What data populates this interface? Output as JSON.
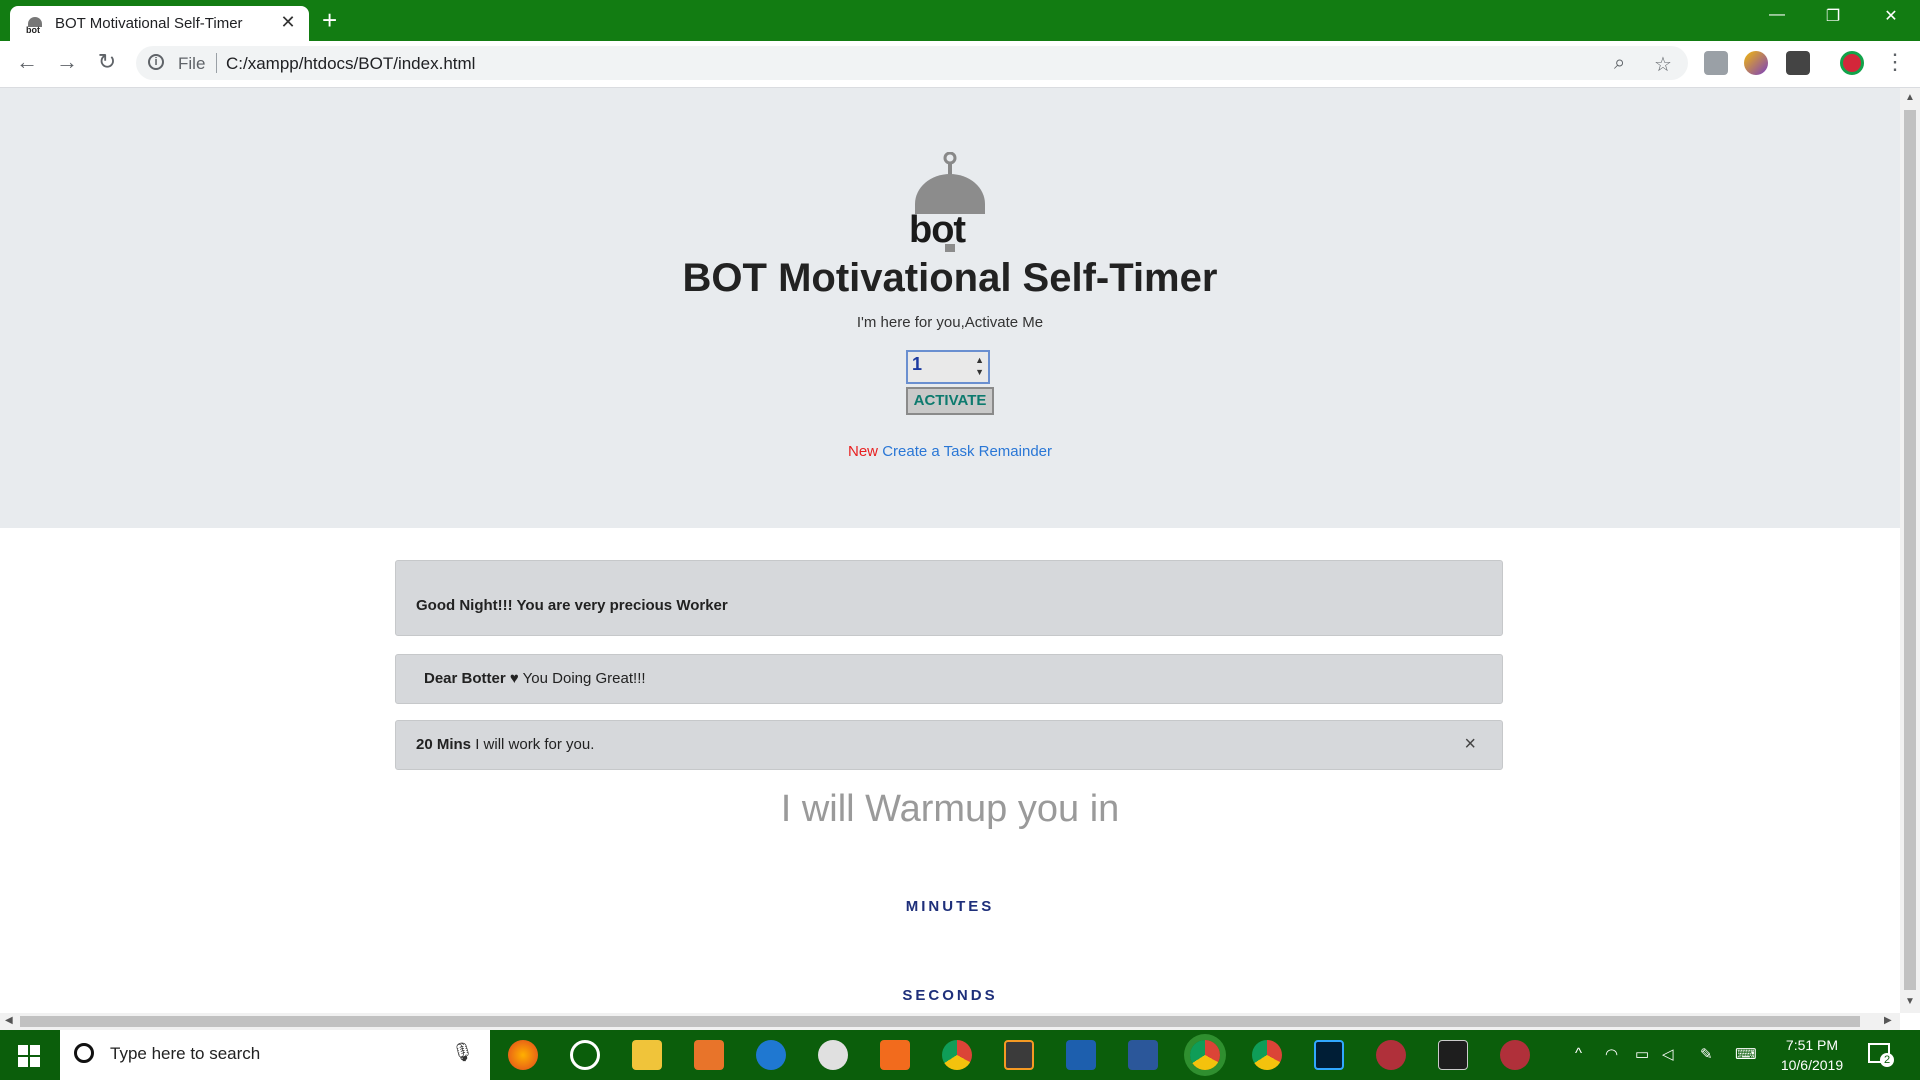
{
  "browser": {
    "tab_title": "BOT Motivational Self-Timer",
    "tab_close": "✕",
    "new_tab": "+",
    "window_controls": [
      "—",
      "❐",
      "✕"
    ],
    "url_scheme_label": "File",
    "url": "C:/xampp/htdocs/BOT/index.html"
  },
  "hero": {
    "title": "BOT Motivational Self-Timer",
    "subtitle": "I'm here for you,Activate Me",
    "input_value": "1",
    "activate_label": "ACTIVATE",
    "new_badge": "New",
    "task_link": "Create a Task Remainder"
  },
  "alerts": {
    "greeting": "Good Night!!! You are very precious Worker",
    "dear_bold": "Dear Botter ♥",
    "dear_text": "You Doing Great!!!",
    "mins_bold": "20 Mins",
    "mins_text": "I will work for you.",
    "close": "×"
  },
  "timer": {
    "heading": "I will Warmup you in",
    "minutes_label": "MINUTES",
    "seconds_label": "SECONDS"
  },
  "taskbar": {
    "search_placeholder": "Type here to search",
    "time": "7:51 PM",
    "date": "10/6/2019",
    "notification_count": "2"
  },
  "colors": {
    "titlebar": "#127c12",
    "taskbar": "#0b5e0b",
    "accent_link": "#2a77d6",
    "new_red": "#e82020",
    "activate_text": "#0d7a6e"
  }
}
